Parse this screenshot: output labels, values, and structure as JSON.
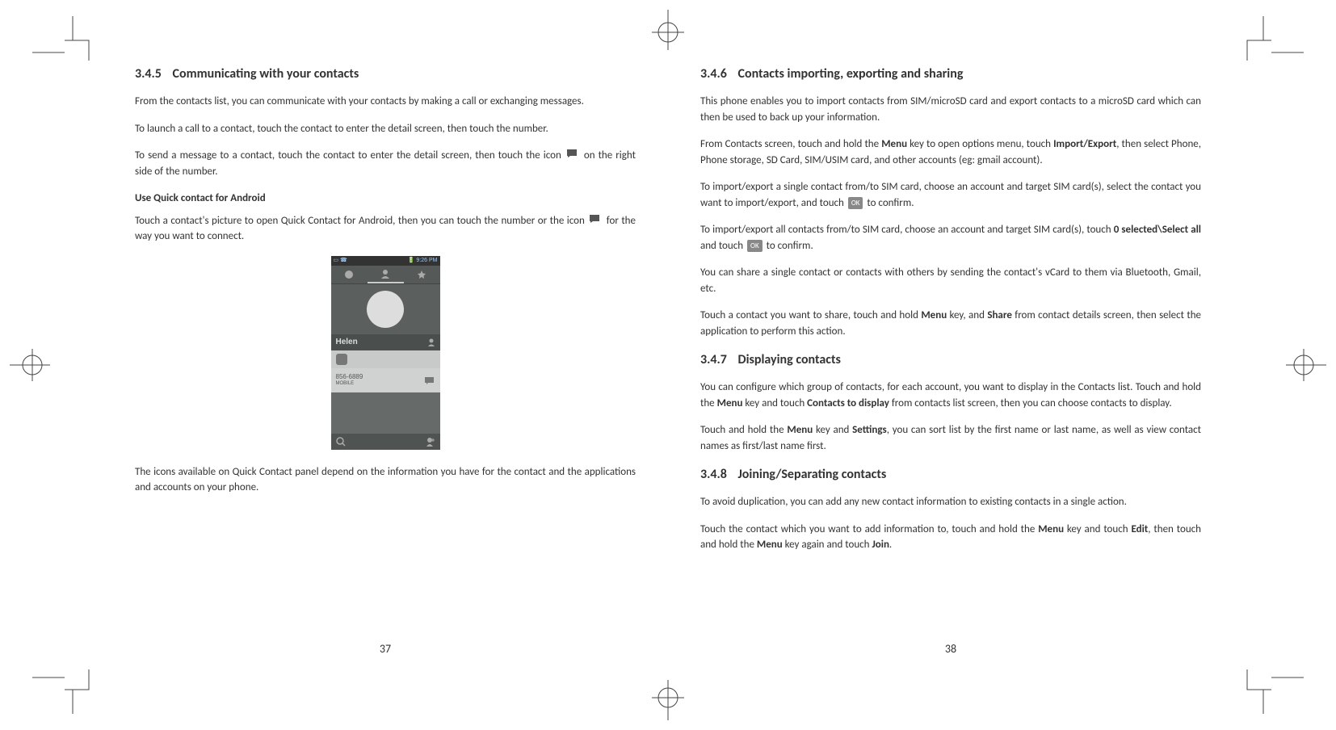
{
  "left": {
    "heading_num": "3.4.5",
    "heading_text": "Communicating with your contacts",
    "p1": "From the contacts list, you can communicate with your contacts by making a call or exchanging messages.",
    "p2": "To launch a call to a contact, touch the contact to enter the detail screen, then touch the number.",
    "p3a": "To send a message to a contact, touch the contact to enter the detail screen, then touch the icon",
    "p3b": "on the right side of the number.",
    "subhead": "Use Quick contact for Android",
    "p4a": "Touch a contact's picture to open Quick Contact for Android, then you can touch the number or the icon",
    "p4b": "for the way you want to connect.",
    "p5": "The icons available on Quick Contact panel depend on the information you have for the contact and the applications and accounts on your phone.",
    "page_num": "37",
    "shot": {
      "time": "9:26 PM",
      "name": "Helen",
      "number": "856-6889",
      "type": "MOBILE"
    }
  },
  "right": {
    "s1": {
      "heading_num": "3.4.6",
      "heading_text": "Contacts importing, exporting and sharing",
      "p1": "This phone enables you to import contacts from SIM/microSD card and export contacts to a microSD card which can then be used to back up your information.",
      "p2a": "From Contacts screen, touch and hold the ",
      "p2b": " key to open options menu, touch ",
      "p2c": ", then select Phone, Phone storage, SD Card, SIM/USIM card, and other accounts (eg: gmail account).",
      "menu": "Menu",
      "import_export": "Import/Export",
      "p3a": "To import/export a single contact from/to SIM card, choose an account and target SIM card(s), select the contact you want to import/export, and touch",
      "p3b": "to confirm.",
      "ok": "OK",
      "p4a": "To import/export all contacts from/to SIM card, choose an account and target SIM card(s), touch ",
      "zero_selected": "0 selected\\Select all",
      "p4b": " and touch",
      "p4c": "to confirm.",
      "p5": "You can share a single contact or contacts with others by sending the contact's vCard to them via Bluetooth, Gmail, etc.",
      "p6a": "Touch a contact you want to share, touch and hold ",
      "p6b": " key, and ",
      "share": "Share",
      "p6c": " from contact details screen, then select the application to perform this action."
    },
    "s2": {
      "heading_num": "3.4.7",
      "heading_text": "Displaying contacts",
      "p1a": "You can configure which group of contacts, for each account, you want to display in the Contacts list. Touch and hold the ",
      "menu": "Menu",
      "p1b": " key and touch ",
      "ctd": "Contacts to display",
      "p1c": " from contacts list screen, then you can choose contacts to display.",
      "p2a": "Touch and hold the ",
      "p2b": " key and ",
      "settings": "Settings",
      "p2c": ", you can sort list by the first name or last name, as well as view contact names as first/last name first."
    },
    "s3": {
      "heading_num": "3.4.8",
      "heading_text": "Joining/Separating contacts",
      "p1": "To avoid duplication, you can add any new contact information to existing contacts in a single action.",
      "p2a": "Touch the contact which you want to add information to, touch and hold the ",
      "menu": "Menu",
      "p2b": " key and touch ",
      "edit": "Edit",
      "p2c": ", then touch and hold the ",
      "p2d": " key again and touch ",
      "join": "Join",
      "p2e": "."
    },
    "page_num": "38"
  }
}
